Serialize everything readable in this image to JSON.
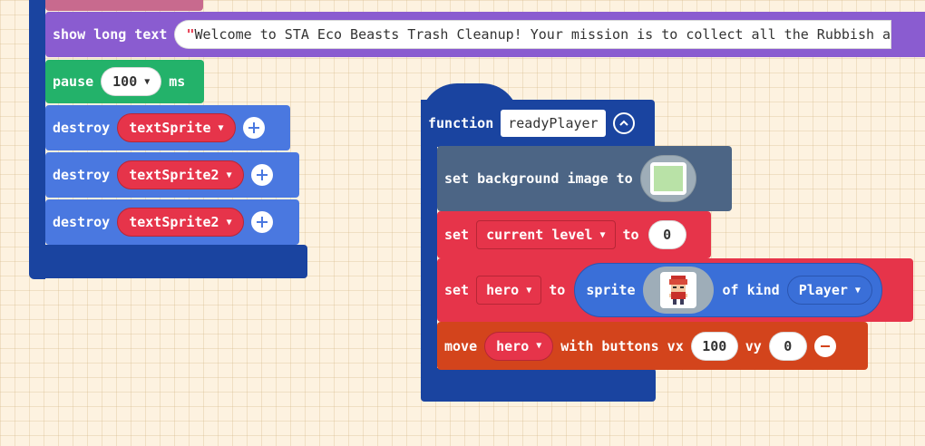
{
  "colors": {
    "workspace_bg": "#fdf2e0",
    "function_block": "#1a44a0",
    "text_block": "#8a5cd0",
    "pause_block": "#23b26a",
    "destroy_block": "#4a78e0",
    "scene_block": "#4c6585",
    "variable_block": "#e6344a",
    "controller_block": "#d3441c",
    "sprite_block": "#3a6fd8",
    "image_preview": "#b9e2a7"
  },
  "left_stack": {
    "show_long_text": {
      "keyword": "show long text",
      "quote": "\"",
      "text": "Welcome to STA Eco Beasts Trash Cleanup! Your mission is to collect all the Rubbish a"
    },
    "pause": {
      "keyword": "pause",
      "value": "100",
      "unit": "ms"
    },
    "destroy_rows": [
      {
        "keyword": "destroy",
        "target": "textSprite"
      },
      {
        "keyword": "destroy",
        "target": "textSprite2"
      },
      {
        "keyword": "destroy",
        "target": "textSprite2"
      }
    ]
  },
  "function_block": {
    "keyword": "function",
    "name": "readyPlayer",
    "set_background": {
      "keyword": "set background image to"
    },
    "set_level": {
      "keyword": "set",
      "variable": "current level",
      "to": "to",
      "value": "0"
    },
    "set_hero": {
      "keyword": "set",
      "variable": "hero",
      "to": "to",
      "sprite_keyword": "sprite",
      "of_kind": "of kind",
      "kind": "Player"
    },
    "move_hero": {
      "keyword": "move",
      "variable": "hero",
      "with_buttons": "with buttons vx",
      "vx": "100",
      "vy_label": "vy",
      "vy": "0"
    }
  }
}
